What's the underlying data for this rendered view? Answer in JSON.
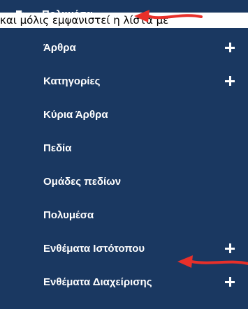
{
  "top_item": {
    "label": "Πολυμέσα",
    "icon": "document-icon",
    "action_icon": "grid-icon"
  },
  "overlay_caption": "και μόλις εμφανιστεί η λίστα με",
  "menu": {
    "items": [
      {
        "label": "Άρθρα",
        "action": "+"
      },
      {
        "label": "Κατηγορίες",
        "action": "+"
      },
      {
        "label": "Κύρια Άρθρα",
        "action": ""
      },
      {
        "label": "Πεδία",
        "action": ""
      },
      {
        "label": "Ομάδες πεδίων",
        "action": ""
      },
      {
        "label": "Πολυμέσα",
        "action": ""
      },
      {
        "label": "Ενθέματα Ιστότοπου",
        "action": "+"
      },
      {
        "label": "Ενθέματα Διαχείρισης",
        "action": "+"
      }
    ]
  },
  "colors": {
    "sidebar_bg": "#1a3861",
    "text": "#ffffff",
    "arrow": "#e8302a"
  }
}
